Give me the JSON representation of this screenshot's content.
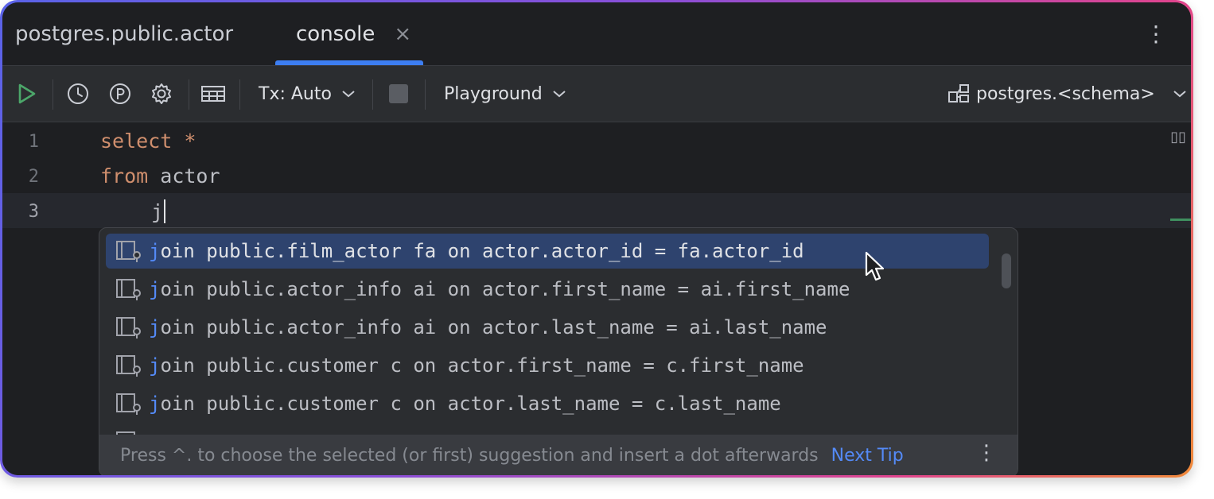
{
  "tabs": {
    "inactive_label": "postgres.public.actor",
    "active_label": "console",
    "close_glyph": "×",
    "more_glyph": "⋮"
  },
  "toolbar": {
    "run_icon": "run-icon",
    "history_icon": "history-icon",
    "parameters_icon": "parameters-icon",
    "settings_icon": "gear-icon",
    "table_icon": "table-icon",
    "tx_label": "Tx: Auto",
    "stop_icon": "stop-icon",
    "mode_label": "Playground",
    "schema_label": "postgres.<schema>",
    "accent_run": "#4ca76a"
  },
  "editor": {
    "lines": [
      {
        "number": "1",
        "keyword": "select",
        "rest": " *"
      },
      {
        "number": "2",
        "keyword": "from",
        "rest": " actor"
      },
      {
        "number": "3",
        "keyword": "",
        "rest": "j"
      }
    ],
    "reader_mode_glyph": "▯▯"
  },
  "completion": {
    "items": [
      {
        "match": "j",
        "rest": "oin public.film_actor fa on actor.actor_id = fa.actor_id",
        "selected": true
      },
      {
        "match": "j",
        "rest": "oin public.actor_info ai on actor.first_name = ai.first_name",
        "selected": false
      },
      {
        "match": "j",
        "rest": "oin public.actor_info ai on actor.last_name = ai.last_name",
        "selected": false
      },
      {
        "match": "j",
        "rest": "oin public.customer c on actor.first_name = c.first_name",
        "selected": false
      },
      {
        "match": "j",
        "rest": "oin public.customer c on actor.last_name = c.last_name",
        "selected": false
      }
    ],
    "footer_hint": "Press ^. to choose the selected (or first) suggestion and insert a dot afterwards",
    "next_tip_label": "Next Tip",
    "more_glyph": "⋮",
    "highlight_color": "#2e436e"
  }
}
